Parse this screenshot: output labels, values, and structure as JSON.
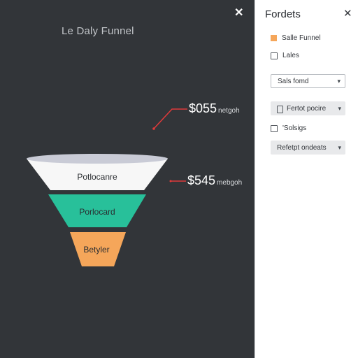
{
  "canvas": {
    "title": "Le Daly Funnel",
    "close_icon": "close-icon",
    "background": "#323539"
  },
  "funnel": {
    "stages": [
      {
        "label": "Potlocanre",
        "color": "#f7f7f7"
      },
      {
        "label": "Porlocard",
        "color": "#28c09a"
      },
      {
        "label": "Betyler",
        "color": "#f5a65a"
      }
    ],
    "callouts": [
      {
        "value": "$055",
        "unit": "netgoh",
        "line_color": "#e03a3a"
      },
      {
        "value": "$545",
        "unit": "mebgoh",
        "line_color": "#e03a3a"
      }
    ]
  },
  "panel": {
    "title": "Fordets",
    "close_icon": "close-icon",
    "legend_item": {
      "label": "Salle Funnel",
      "color": "#f5a65a"
    },
    "checkbox_1": {
      "label": "Lales",
      "checked": false
    },
    "select_1": {
      "value": "Sals fomd"
    },
    "select_2": {
      "value": "Fertot pocire"
    },
    "checkbox_2": {
      "label": "'Solsigs",
      "checked": false
    },
    "select_3": {
      "value": "Refetpt ondeats"
    }
  }
}
